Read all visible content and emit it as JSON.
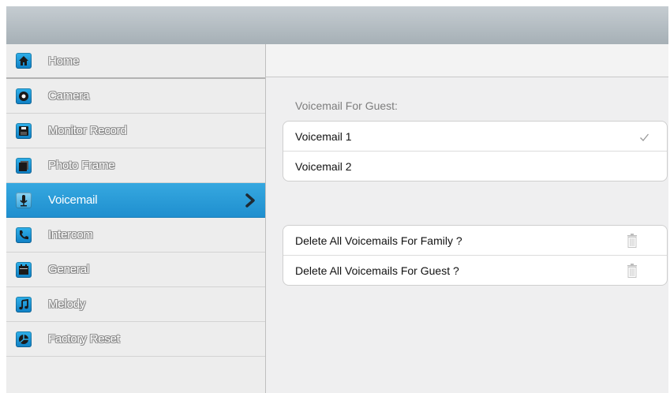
{
  "sidebar": {
    "items": [
      {
        "label": "Home",
        "icon": "home-icon",
        "active": false
      },
      {
        "label": "Camera",
        "icon": "camera-icon",
        "active": false
      },
      {
        "label": "Monitor Record",
        "icon": "floppy-disk-icon",
        "active": false
      },
      {
        "label": "Photo Frame",
        "icon": "photo-frame-icon",
        "active": false
      },
      {
        "label": "Voicemail",
        "icon": "microphone-icon",
        "active": true
      },
      {
        "label": "Intercom",
        "icon": "phone-icon",
        "active": false
      },
      {
        "label": "General",
        "icon": "calendar-icon",
        "active": false
      },
      {
        "label": "Melody",
        "icon": "music-note-icon",
        "active": false
      },
      {
        "label": "Factory Reset",
        "icon": "reset-icon",
        "active": false
      }
    ],
    "active_chevron_icon": "chevron-right-icon"
  },
  "main": {
    "section_label": "Voicemail For Guest:",
    "voicemail_options": [
      {
        "label": "Voicemail 1",
        "selected": true
      },
      {
        "label": "Voicemail 2",
        "selected": false
      }
    ],
    "delete_actions": [
      {
        "label": "Delete All Voicemails For Family ?",
        "icon": "trash-icon"
      },
      {
        "label": "Delete All Voicemails For Guest ?",
        "icon": "trash-icon"
      }
    ]
  },
  "colors": {
    "active_item": "#2a9cd9",
    "icon_blue": "#1a8fd2",
    "top_bar": "#b0b9bf"
  }
}
